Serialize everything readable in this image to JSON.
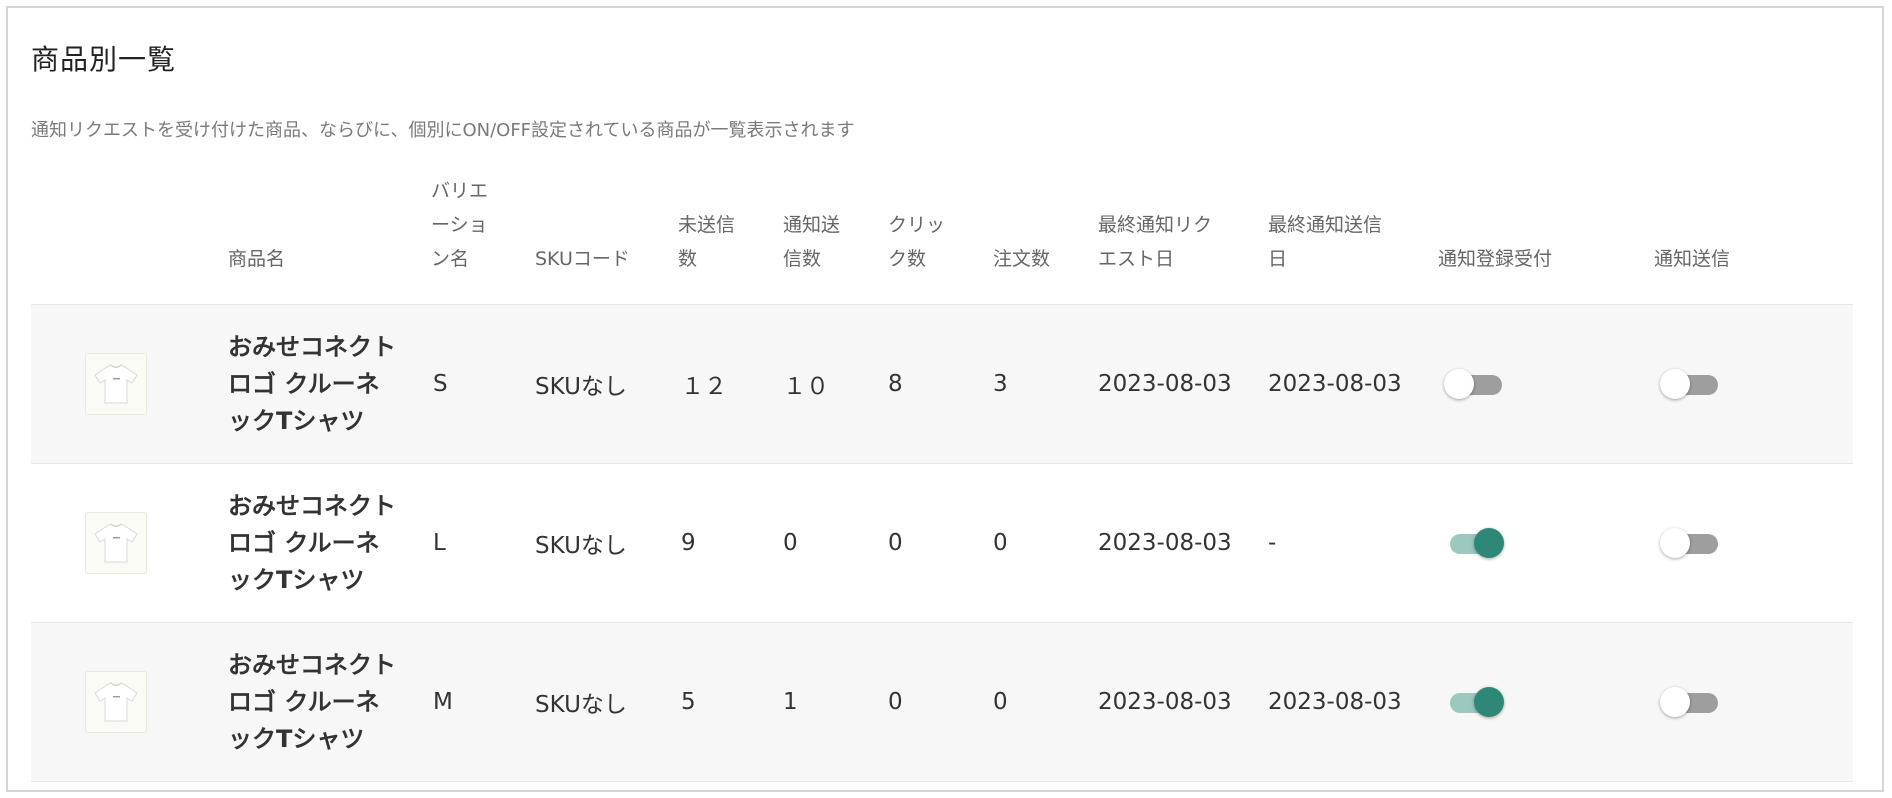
{
  "section": {
    "title": "商品別一覧",
    "description": "通知リクエストを受け付けた商品、ならびに、個別にON/OFF設定されている商品が一覧表示されます"
  },
  "columns": {
    "product_name": [
      "商品名"
    ],
    "variation_name": [
      "バリエ",
      "ーショ",
      "ン名"
    ],
    "sku_code": [
      "SKUコード"
    ],
    "unsent_count": [
      "未送信",
      "数"
    ],
    "sent_count": [
      "通知送",
      "信数"
    ],
    "click_count": [
      "クリッ",
      "ク数"
    ],
    "order_count": [
      "注文数"
    ],
    "last_request_date": [
      "最終通知リク",
      "エスト日"
    ],
    "last_sent_date": [
      "最終通知送信",
      "日"
    ],
    "registration_toggle": [
      "通知登録受付"
    ],
    "send_toggle": [
      "通知送信"
    ]
  },
  "rows": [
    {
      "name_lines": [
        "おみせコネクト",
        "ロゴ クルーネ",
        "ックTシャツ"
      ],
      "variation": "S",
      "sku": "SKUなし",
      "unsent": "１２",
      "sent": "１０",
      "clicks": "8",
      "orders": "3",
      "last_request": "2023-08-03",
      "last_sent": "2023-08-03",
      "registration_on": false,
      "send_on": false
    },
    {
      "name_lines": [
        "おみせコネクト",
        "ロゴ クルーネ",
        "ックTシャツ"
      ],
      "variation": "L",
      "sku": "SKUなし",
      "unsent": "9",
      "sent": "0",
      "clicks": "0",
      "orders": "0",
      "last_request": "2023-08-03",
      "last_sent": "-",
      "registration_on": true,
      "send_on": false
    },
    {
      "name_lines": [
        "おみせコネクト",
        "ロゴ クルーネ",
        "ックTシャツ"
      ],
      "variation": "M",
      "sku": "SKUなし",
      "unsent": "5",
      "sent": "1",
      "clicks": "0",
      "orders": "0",
      "last_request": "2023-08-03",
      "last_sent": "2023-08-03",
      "registration_on": true,
      "send_on": false
    }
  ],
  "icons": {
    "thumbnail": "tshirt-thumbnail-icon"
  },
  "colors": {
    "toggle_on_knob": "#2f8877",
    "toggle_on_track": "#9cc8bd",
    "toggle_off_track": "#9e9e9e",
    "row_shade": "#f7f7f7"
  }
}
